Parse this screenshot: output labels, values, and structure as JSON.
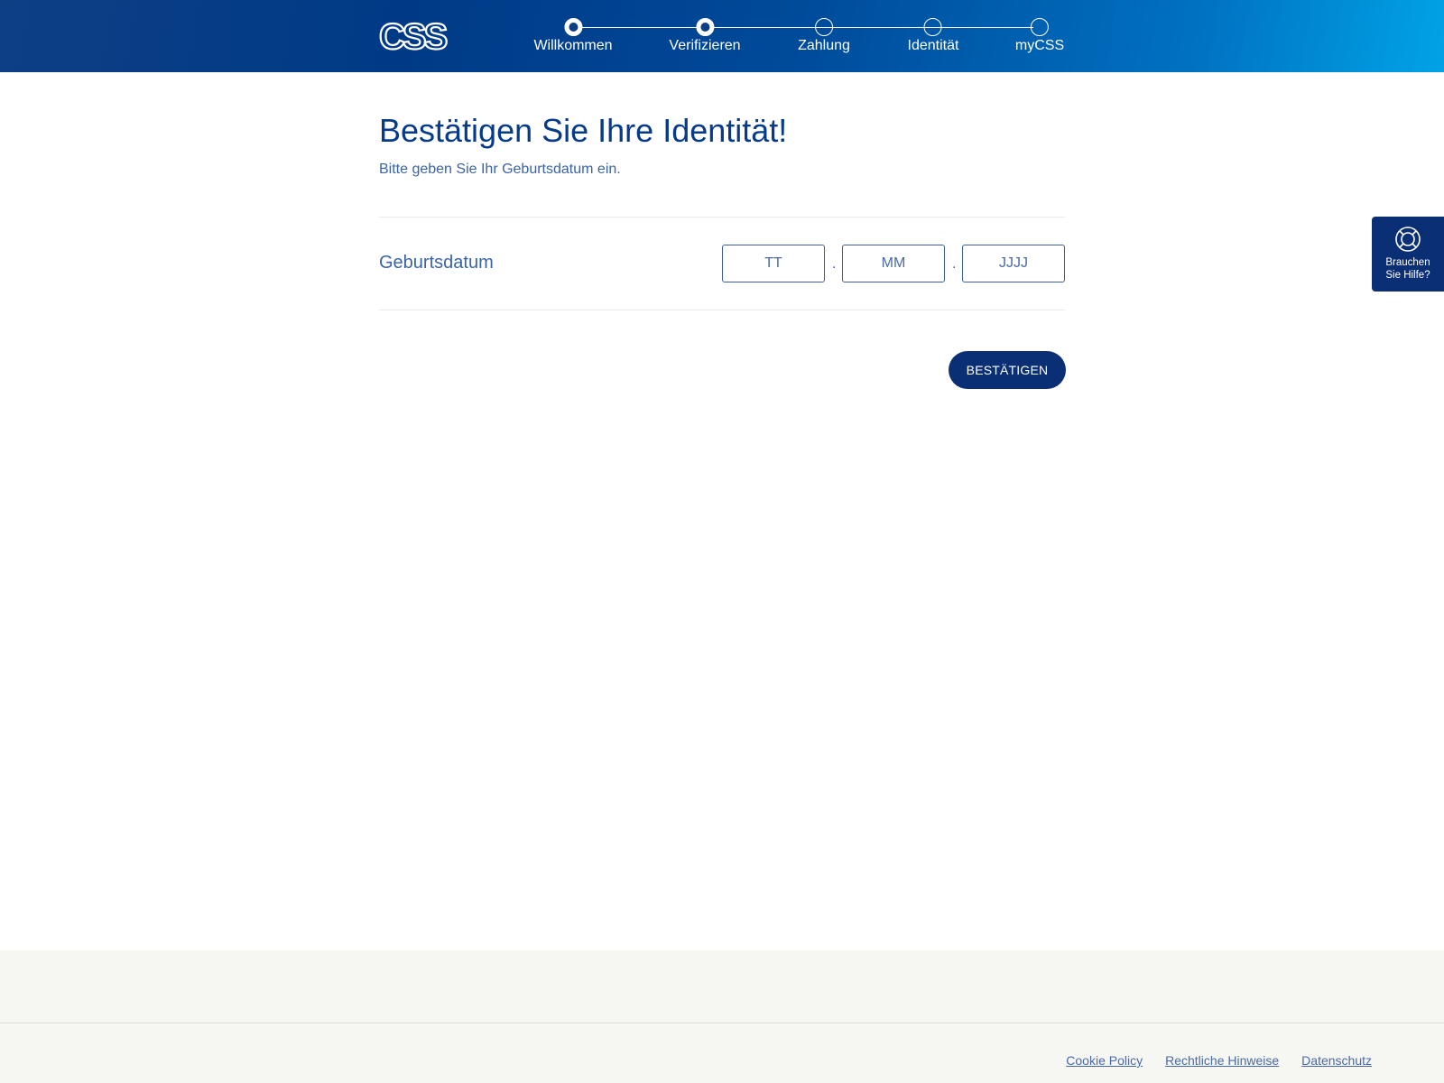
{
  "header": {
    "logo_text": "CSS",
    "steps": [
      {
        "label": "Willkommen",
        "state": "done"
      },
      {
        "label": "Verifizieren",
        "state": "done"
      },
      {
        "label": "Zahlung",
        "state": "pending"
      },
      {
        "label": "Identität",
        "state": "pending"
      },
      {
        "label": "myCSS",
        "state": "pending"
      }
    ]
  },
  "main": {
    "title": "Bestätigen Sie Ihre Identität!",
    "subtitle": "Bitte geben Sie Ihr Geburtsdatum ein.",
    "field_label": "Geburtsdatum",
    "day_placeholder": "TT",
    "month_placeholder": "MM",
    "year_placeholder": "JJJJ",
    "separator": ".",
    "confirm_label": "BESTÄTIGEN"
  },
  "help": {
    "label": "Brauchen\nSie Hilfe?",
    "icon": "lifebuoy-icon"
  },
  "footer": {
    "links": [
      "Cookie Policy",
      "Rechtliche Hinweise",
      "Datenschutz"
    ]
  },
  "colors": {
    "primary": "#0b2f75",
    "accent": "#00a3e6",
    "text": "#063b8a",
    "footer_bg": "#f6f6f3"
  }
}
